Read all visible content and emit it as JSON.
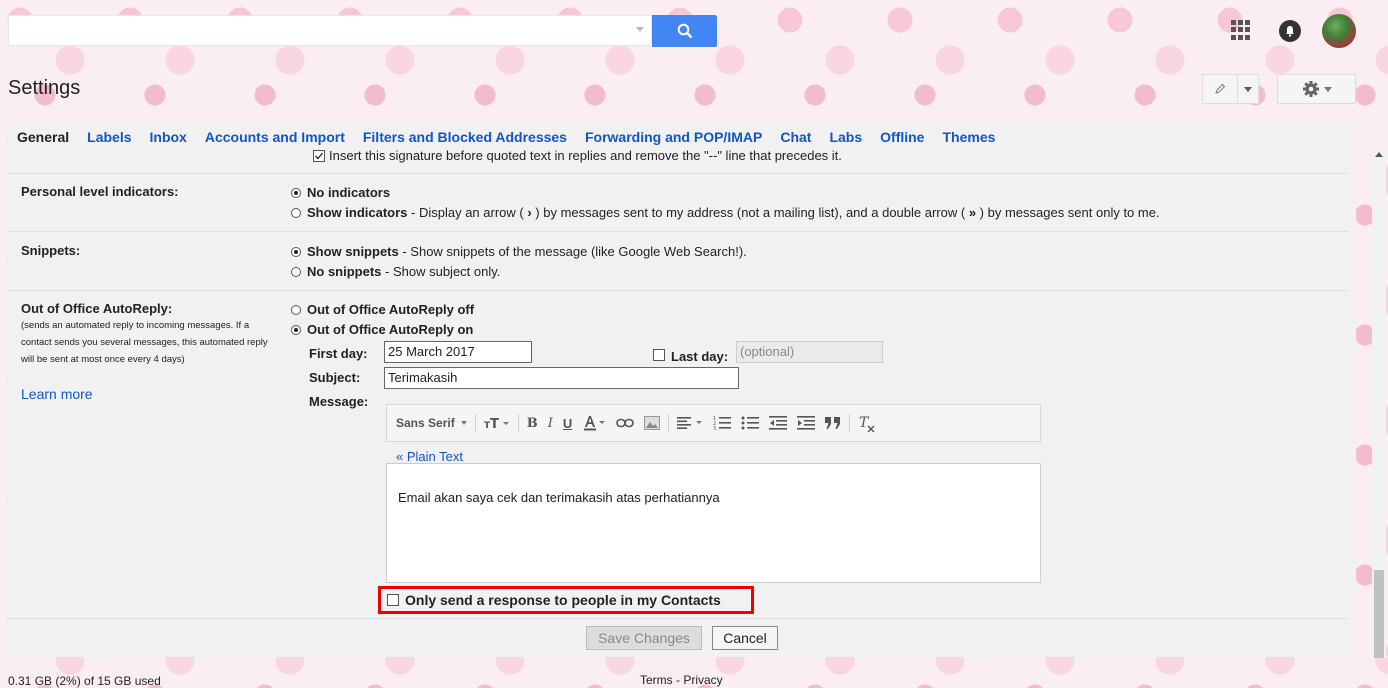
{
  "search": {
    "placeholder": ""
  },
  "header": {
    "title": "Settings"
  },
  "icons": {
    "search": "search-icon",
    "apps": "apps-grid-icon",
    "notifications": "notifications-icon",
    "compose": "pencil-icon",
    "settings": "gear-icon"
  },
  "tabs": [
    {
      "label": "General",
      "active": true
    },
    {
      "label": "Labels"
    },
    {
      "label": "Inbox"
    },
    {
      "label": "Accounts and Import"
    },
    {
      "label": "Filters and Blocked Addresses"
    },
    {
      "label": "Forwarding and POP/IMAP"
    },
    {
      "label": "Chat"
    },
    {
      "label": "Labs"
    },
    {
      "label": "Offline"
    },
    {
      "label": "Themes"
    }
  ],
  "signature": {
    "insert_before_quote": "Insert this signature before quoted text in replies and remove the \"--\" line that precedes it."
  },
  "personal_level": {
    "label": "Personal level indicators:",
    "no_indicators": "No indicators",
    "show_indicators": "Show indicators",
    "show_desc_a": " - Display an arrow ( ",
    "arrow_single": "›",
    "show_desc_b": " ) by messages sent to my address (not a mailing list), and a double arrow ( ",
    "arrow_double": "»",
    "show_desc_c": " ) by messages sent only to me."
  },
  "snippets": {
    "label": "Snippets:",
    "show": "Show snippets",
    "show_desc": " - Show snippets of the message (like Google Web Search!).",
    "no": "No snippets",
    "no_desc": " - Show subject only."
  },
  "ooo": {
    "label": "Out of Office AutoReply:",
    "note": "(sends an automated reply to incoming messages. If a contact sends you several messages, this automated reply will be sent at most once every 4 days)",
    "learn_more": "Learn more",
    "off": "Out of Office AutoReply off",
    "on": "Out of Office AutoReply on",
    "first_day_label": "First day:",
    "first_day_value": "25 March 2017",
    "last_day_label": "Last day:",
    "last_day_placeholder": "(optional)",
    "subject_label": "Subject:",
    "subject_value": "Terimakasih",
    "message_label": "Message:",
    "font_name": "Sans Serif",
    "plain_text": "« Plain Text",
    "message_body": "Email akan saya cek dan terimakasih atas perhatiannya",
    "contacts_only": "Only send a response to people in my Contacts"
  },
  "actions": {
    "save": "Save Changes",
    "cancel": "Cancel"
  },
  "footer": {
    "storage": "0.31 GB (2%) of 15 GB used",
    "terms": "Terms - Privacy"
  },
  "colors": {
    "accent": "#4285f4",
    "link": "#1155cc",
    "highlight": "#ee0000"
  }
}
